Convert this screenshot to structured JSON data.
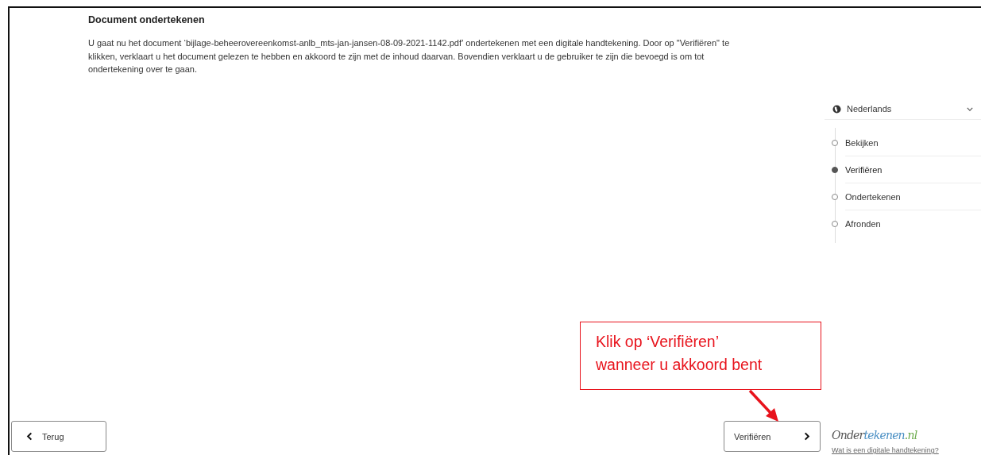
{
  "title": "Document ondertekenen",
  "description": "U gaat nu het document ‘bijlage-beheerovereenkomst-anlb_mts-jan-jansen-08-09-2021-1142.pdf’ ondertekenen met een digitale handtekening. Door op \"Verifiëren\" te klikken, verklaart u het document gelezen te hebben en akkoord te zijn met de inhoud daarvan. Bovendien verklaart u de gebruiker te zijn die bevoegd is om tot ondertekening over te gaan.",
  "language": {
    "label": "Nederlands"
  },
  "steps": [
    {
      "label": "Bekijken",
      "selected": false
    },
    {
      "label": "Verifiëren",
      "selected": true
    },
    {
      "label": "Ondertekenen",
      "selected": false
    },
    {
      "label": "Afronden",
      "selected": false
    }
  ],
  "back_button": {
    "label": "Terug"
  },
  "next_button": {
    "label": "Verifiëren"
  },
  "logo": [
    {
      "text": "Onder",
      "color": "#555555"
    },
    {
      "text": "tekenen",
      "color": "#4a8fc4"
    },
    {
      "text": ".nl",
      "color": "#6aaa4a"
    }
  ],
  "help_link": "Wat is een digitale handtekening?",
  "callout": {
    "lines": [
      "Klik op ‘Verifiëren’",
      "wanneer u akkoord bent"
    ]
  }
}
